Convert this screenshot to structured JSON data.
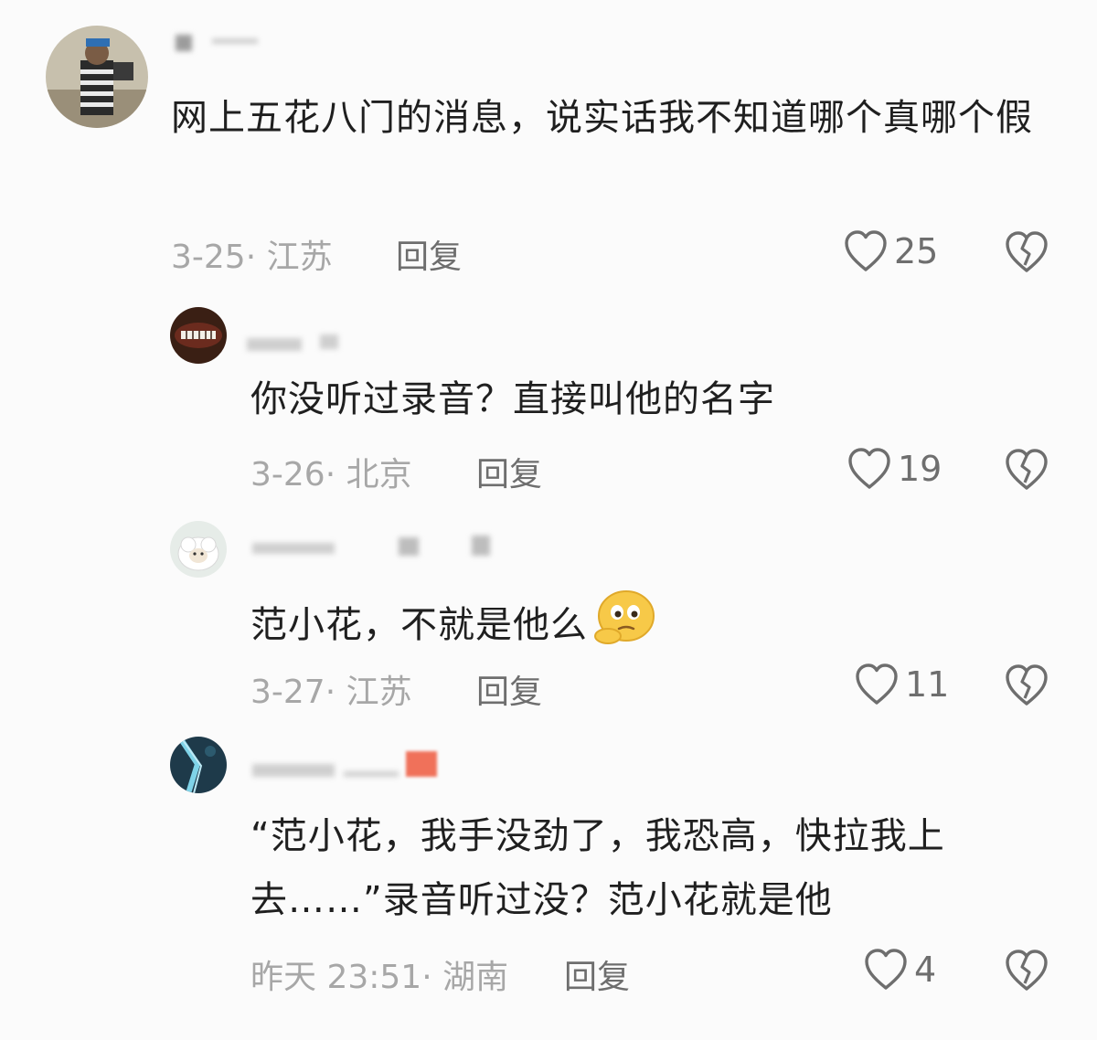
{
  "comments": [
    {
      "text": "网上五花八门的消息，说实话我不知道哪个真哪个假",
      "meta": "3-25· 江苏",
      "reply_label": "回复",
      "likes": "25"
    },
    {
      "text": "你没听过录音？直接叫他的名字",
      "meta": "3-26· 北京",
      "reply_label": "回复",
      "likes": "19"
    },
    {
      "text": "范小花，不就是他么",
      "meta": "3-27· 江苏",
      "reply_label": "回复",
      "likes": "11"
    },
    {
      "text_line1": "“范小花，我手没劲了，我恐高，快拉我上",
      "text_line2": "去……”录音听过没？范小花就是他",
      "meta": "昨天 23:51· 湖南",
      "reply_label": "回复",
      "likes": "4"
    }
  ],
  "icons": {
    "like": "heart-outline-icon",
    "dislike": "broken-heart-icon",
    "emoji": "thinking-face-emoji"
  },
  "colors": {
    "text": "#1f1f1f",
    "meta": "#a7a7a7",
    "action": "#6e6e6e",
    "background": "#fbfbfb"
  }
}
